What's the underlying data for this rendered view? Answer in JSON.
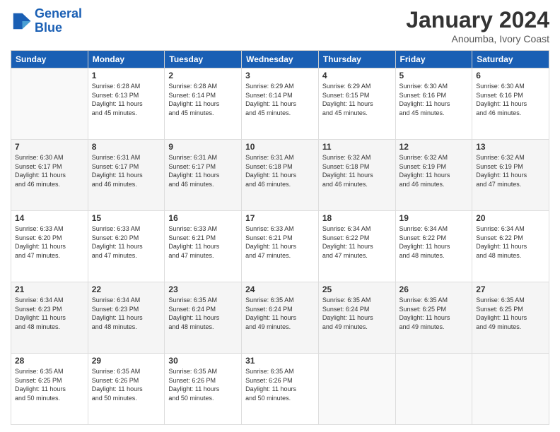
{
  "logo": {
    "line1": "General",
    "line2": "Blue"
  },
  "title": "January 2024",
  "subtitle": "Anoumba, Ivory Coast",
  "days_of_week": [
    "Sunday",
    "Monday",
    "Tuesday",
    "Wednesday",
    "Thursday",
    "Friday",
    "Saturday"
  ],
  "weeks": [
    [
      {
        "day": "",
        "content": ""
      },
      {
        "day": "1",
        "content": "Sunrise: 6:28 AM\nSunset: 6:13 PM\nDaylight: 11 hours\nand 45 minutes."
      },
      {
        "day": "2",
        "content": "Sunrise: 6:28 AM\nSunset: 6:14 PM\nDaylight: 11 hours\nand 45 minutes."
      },
      {
        "day": "3",
        "content": "Sunrise: 6:29 AM\nSunset: 6:14 PM\nDaylight: 11 hours\nand 45 minutes."
      },
      {
        "day": "4",
        "content": "Sunrise: 6:29 AM\nSunset: 6:15 PM\nDaylight: 11 hours\nand 45 minutes."
      },
      {
        "day": "5",
        "content": "Sunrise: 6:30 AM\nSunset: 6:16 PM\nDaylight: 11 hours\nand 45 minutes."
      },
      {
        "day": "6",
        "content": "Sunrise: 6:30 AM\nSunset: 6:16 PM\nDaylight: 11 hours\nand 46 minutes."
      }
    ],
    [
      {
        "day": "7",
        "content": "Sunrise: 6:30 AM\nSunset: 6:17 PM\nDaylight: 11 hours\nand 46 minutes."
      },
      {
        "day": "8",
        "content": "Sunrise: 6:31 AM\nSunset: 6:17 PM\nDaylight: 11 hours\nand 46 minutes."
      },
      {
        "day": "9",
        "content": "Sunrise: 6:31 AM\nSunset: 6:17 PM\nDaylight: 11 hours\nand 46 minutes."
      },
      {
        "day": "10",
        "content": "Sunrise: 6:31 AM\nSunset: 6:18 PM\nDaylight: 11 hours\nand 46 minutes."
      },
      {
        "day": "11",
        "content": "Sunrise: 6:32 AM\nSunset: 6:18 PM\nDaylight: 11 hours\nand 46 minutes."
      },
      {
        "day": "12",
        "content": "Sunrise: 6:32 AM\nSunset: 6:19 PM\nDaylight: 11 hours\nand 46 minutes."
      },
      {
        "day": "13",
        "content": "Sunrise: 6:32 AM\nSunset: 6:19 PM\nDaylight: 11 hours\nand 47 minutes."
      }
    ],
    [
      {
        "day": "14",
        "content": "Sunrise: 6:33 AM\nSunset: 6:20 PM\nDaylight: 11 hours\nand 47 minutes."
      },
      {
        "day": "15",
        "content": "Sunrise: 6:33 AM\nSunset: 6:20 PM\nDaylight: 11 hours\nand 47 minutes."
      },
      {
        "day": "16",
        "content": "Sunrise: 6:33 AM\nSunset: 6:21 PM\nDaylight: 11 hours\nand 47 minutes."
      },
      {
        "day": "17",
        "content": "Sunrise: 6:33 AM\nSunset: 6:21 PM\nDaylight: 11 hours\nand 47 minutes."
      },
      {
        "day": "18",
        "content": "Sunrise: 6:34 AM\nSunset: 6:22 PM\nDaylight: 11 hours\nand 47 minutes."
      },
      {
        "day": "19",
        "content": "Sunrise: 6:34 AM\nSunset: 6:22 PM\nDaylight: 11 hours\nand 48 minutes."
      },
      {
        "day": "20",
        "content": "Sunrise: 6:34 AM\nSunset: 6:22 PM\nDaylight: 11 hours\nand 48 minutes."
      }
    ],
    [
      {
        "day": "21",
        "content": "Sunrise: 6:34 AM\nSunset: 6:23 PM\nDaylight: 11 hours\nand 48 minutes."
      },
      {
        "day": "22",
        "content": "Sunrise: 6:34 AM\nSunset: 6:23 PM\nDaylight: 11 hours\nand 48 minutes."
      },
      {
        "day": "23",
        "content": "Sunrise: 6:35 AM\nSunset: 6:24 PM\nDaylight: 11 hours\nand 48 minutes."
      },
      {
        "day": "24",
        "content": "Sunrise: 6:35 AM\nSunset: 6:24 PM\nDaylight: 11 hours\nand 49 minutes."
      },
      {
        "day": "25",
        "content": "Sunrise: 6:35 AM\nSunset: 6:24 PM\nDaylight: 11 hours\nand 49 minutes."
      },
      {
        "day": "26",
        "content": "Sunrise: 6:35 AM\nSunset: 6:25 PM\nDaylight: 11 hours\nand 49 minutes."
      },
      {
        "day": "27",
        "content": "Sunrise: 6:35 AM\nSunset: 6:25 PM\nDaylight: 11 hours\nand 49 minutes."
      }
    ],
    [
      {
        "day": "28",
        "content": "Sunrise: 6:35 AM\nSunset: 6:25 PM\nDaylight: 11 hours\nand 50 minutes."
      },
      {
        "day": "29",
        "content": "Sunrise: 6:35 AM\nSunset: 6:26 PM\nDaylight: 11 hours\nand 50 minutes."
      },
      {
        "day": "30",
        "content": "Sunrise: 6:35 AM\nSunset: 6:26 PM\nDaylight: 11 hours\nand 50 minutes."
      },
      {
        "day": "31",
        "content": "Sunrise: 6:35 AM\nSunset: 6:26 PM\nDaylight: 11 hours\nand 50 minutes."
      },
      {
        "day": "",
        "content": ""
      },
      {
        "day": "",
        "content": ""
      },
      {
        "day": "",
        "content": ""
      }
    ]
  ]
}
